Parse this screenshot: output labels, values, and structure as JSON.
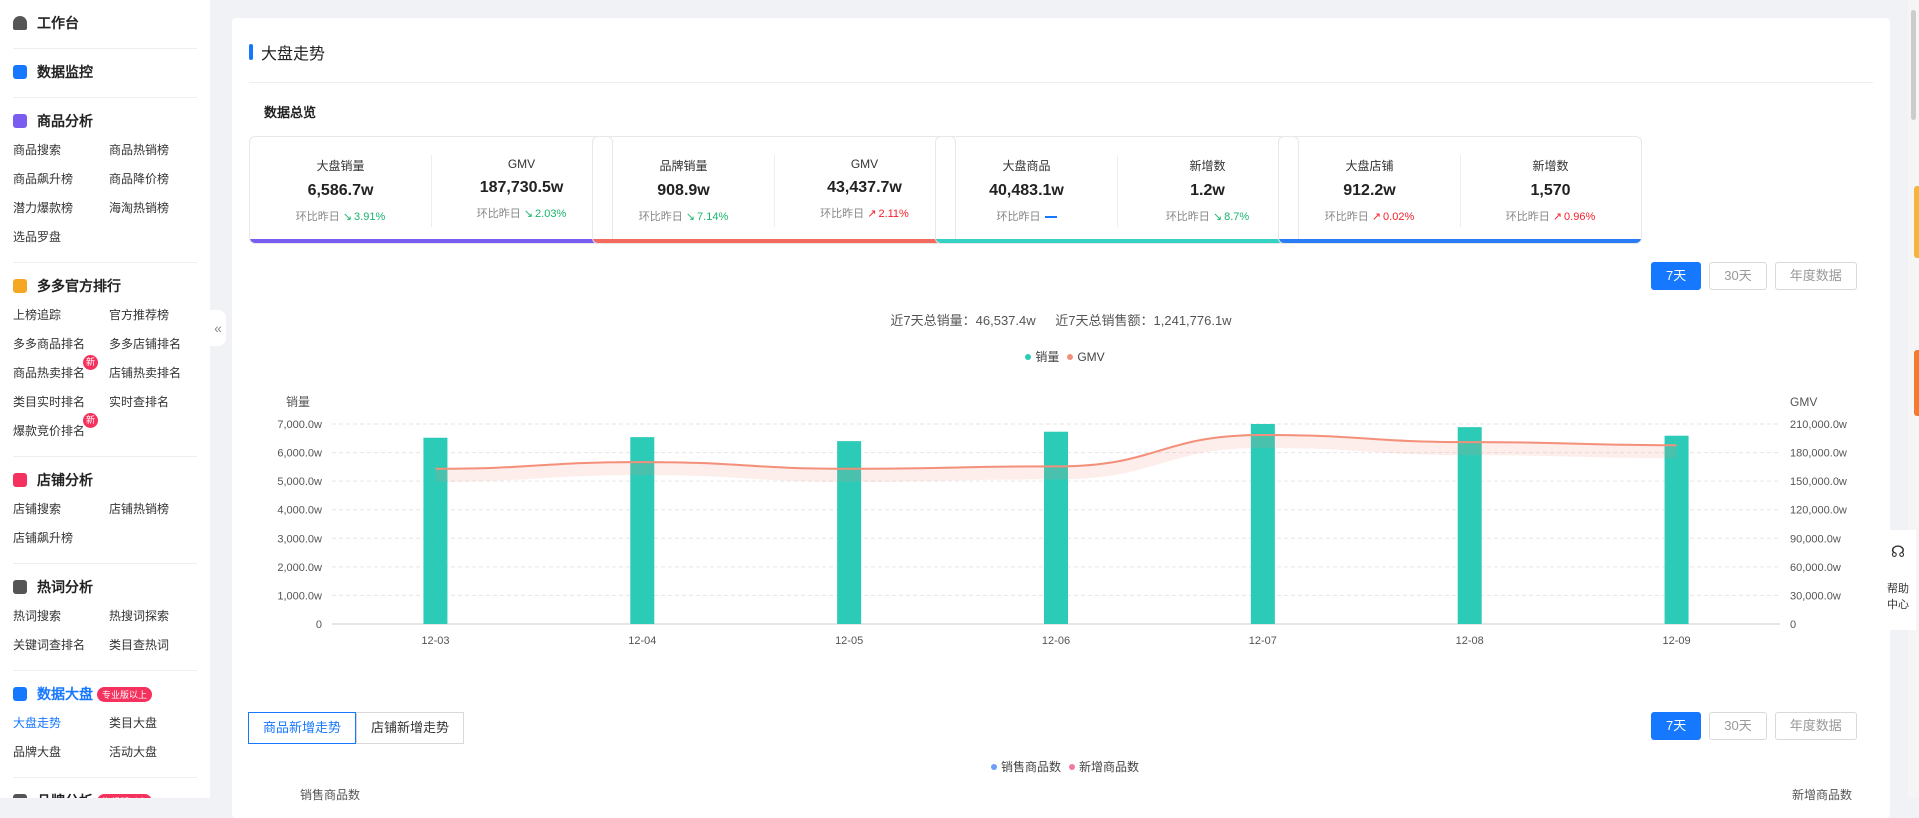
{
  "sidebar": {
    "workbench": "工作台",
    "monitor": "数据监控",
    "sections": [
      {
        "title": "商品分析",
        "color": "#7b5cf0",
        "items": [
          "商品搜索",
          "商品热销榜",
          "商品飙升榜",
          "商品降价榜",
          "潜力爆款榜",
          "海淘热销榜",
          "选品罗盘"
        ]
      },
      {
        "title": "多多官方排行",
        "color": "#f5a623",
        "items": [
          "上榜追踪",
          "官方推荐榜",
          "多多商品排名",
          "多多店铺排名",
          "商品热卖排名",
          "店铺热卖排名",
          "类目实时排名",
          "实时查排名",
          "爆款竞价排名"
        ]
      },
      {
        "title": "店铺分析",
        "color": "#f5315d",
        "items": [
          "店铺搜索",
          "店铺热销榜",
          "店铺飙升榜"
        ]
      },
      {
        "title": "热词分析",
        "color": "#555555",
        "items": [
          "热词搜索",
          "热搜词探索",
          "关键词查排名",
          "类目查热词"
        ]
      },
      {
        "title": "数据大盘",
        "color": "#1677ff",
        "items": [
          "大盘走势",
          "类目大盘",
          "品牌大盘",
          "活动大盘"
        ]
      },
      {
        "title": "品牌分析",
        "color": "#555555",
        "items": []
      }
    ],
    "new_badge": "新",
    "pro_badge": "专业版以上",
    "flagship_badge": "旗舰版以上"
  },
  "page": {
    "title": "大盘走势",
    "overview_title": "数据总览"
  },
  "cards": [
    {
      "accent": "#7b5cf0",
      "left": {
        "label": "大盘销量",
        "value": "6,586.7w",
        "cmp_label": "环比昨日",
        "trend": "down",
        "change": "3.91%"
      },
      "right": {
        "label": "GMV",
        "value": "187,730.5w",
        "cmp_label": "环比昨日",
        "trend": "down",
        "change": "2.03%"
      }
    },
    {
      "accent": "#f56a5f",
      "left": {
        "label": "品牌销量",
        "value": "908.9w",
        "cmp_label": "环比昨日",
        "trend": "down",
        "change": "7.14%"
      },
      "right": {
        "label": "GMV",
        "value": "43,437.7w",
        "cmp_label": "环比昨日",
        "trend": "up",
        "change": "2.11%"
      }
    },
    {
      "accent": "#34d1c4",
      "left": {
        "label": "大盘商品",
        "value": "40,483.1w",
        "cmp_label": "环比昨日",
        "trend": "flat",
        "change": ""
      },
      "right": {
        "label": "新增数",
        "value": "1.2w",
        "cmp_label": "环比昨日",
        "trend": "down",
        "change": "8.7%"
      }
    },
    {
      "accent": "#2a7cf5",
      "left": {
        "label": "大盘店铺",
        "value": "912.2w",
        "cmp_label": "环比昨日",
        "trend": "up",
        "change": "0.02%"
      },
      "right": {
        "label": "新增数",
        "value": "1,570",
        "cmp_label": "环比昨日",
        "trend": "up",
        "change": "0.96%"
      }
    }
  ],
  "range_buttons": [
    "7天",
    "30天",
    "年度数据"
  ],
  "totals": {
    "sales": "近7天总销量：46,537.4w",
    "revenue": "近7天总销售额：1,241,776.1w"
  },
  "chart_data": {
    "type": "bar",
    "categories": [
      "12-03",
      "12-04",
      "12-05",
      "12-06",
      "12-07",
      "12-08",
      "12-09"
    ],
    "series": [
      {
        "name": "销量",
        "type": "bar",
        "axis": "left",
        "color": "#2ccbb7",
        "values": [
          6520,
          6540,
          6400,
          6730,
          7000,
          6890,
          6590
        ]
      },
      {
        "name": "GMV",
        "type": "line",
        "axis": "right",
        "color": "#f4907a",
        "values": [
          163000,
          170000,
          163000,
          165500,
          198500,
          191000,
          187700
        ]
      }
    ],
    "ylabel": "销量",
    "y2label": "GMV",
    "ylim": [
      0,
      7000
    ],
    "y2lim": [
      0,
      210000
    ],
    "yticks": [
      "0",
      "1,000.0w",
      "2,000.0w",
      "3,000.0w",
      "4,000.0w",
      "5,000.0w",
      "6,000.0w",
      "7,000.0w"
    ],
    "y2ticks": [
      "0",
      "30,000.0w",
      "60,000.0w",
      "90,000.0w",
      "120,000.0w",
      "150,000.0w",
      "180,000.0w",
      "210,000.0w"
    ],
    "grid": true,
    "legend": "top-center"
  },
  "section2": {
    "tabs": [
      "商品新增走势",
      "店铺新增走势"
    ],
    "legend": [
      {
        "name": "销售商品数",
        "color": "#6b9ff8"
      },
      {
        "name": "新增商品数",
        "color": "#f27a9a"
      }
    ],
    "ylabel": "销售商品数",
    "y2label": "新增商品数"
  },
  "help": {
    "label1": "帮助",
    "label2": "中心"
  },
  "collapse_glyph": "«"
}
